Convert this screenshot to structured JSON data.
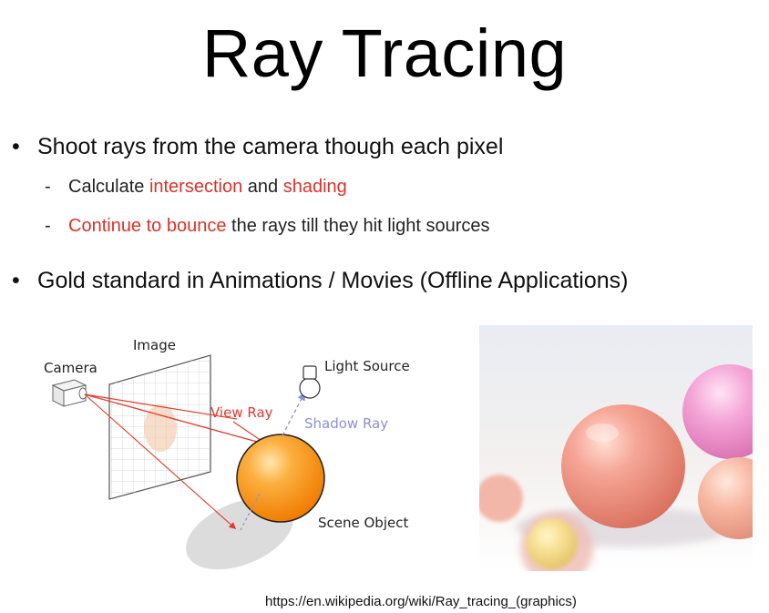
{
  "slide": {
    "title": "Ray Tracing",
    "bullets": [
      {
        "text": "Shoot rays from the camera though each pixel",
        "subs": [
          {
            "parts": [
              "Calculate ",
              "intersection",
              " and ",
              "shading"
            ]
          },
          {
            "parts": [
              "Continue to bounce",
              " the rays till they hit light sources"
            ]
          }
        ]
      },
      {
        "text": "Gold standard in Animations / Movies (Offline Applications)"
      }
    ],
    "bullet_symbol": "•",
    "sub_symbol": "-",
    "highlight_color": "#d9332b"
  },
  "diagram": {
    "labels": {
      "camera": "Camera",
      "image": "Image",
      "light_source": "Light Source",
      "view_ray": "View Ray",
      "shadow_ray": "Shadow Ray",
      "scene_object": "Scene Object"
    },
    "colors": {
      "view_ray": "#e23a2e",
      "shadow_ray": "#8c8fd8",
      "sphere": "#f7941d",
      "shadow": "#d9d9d9"
    }
  },
  "render_image": {
    "description_icon": "rendered-spheres-image"
  },
  "source": "https://en.wikipedia.org/wiki/Ray_tracing_(graphics)"
}
